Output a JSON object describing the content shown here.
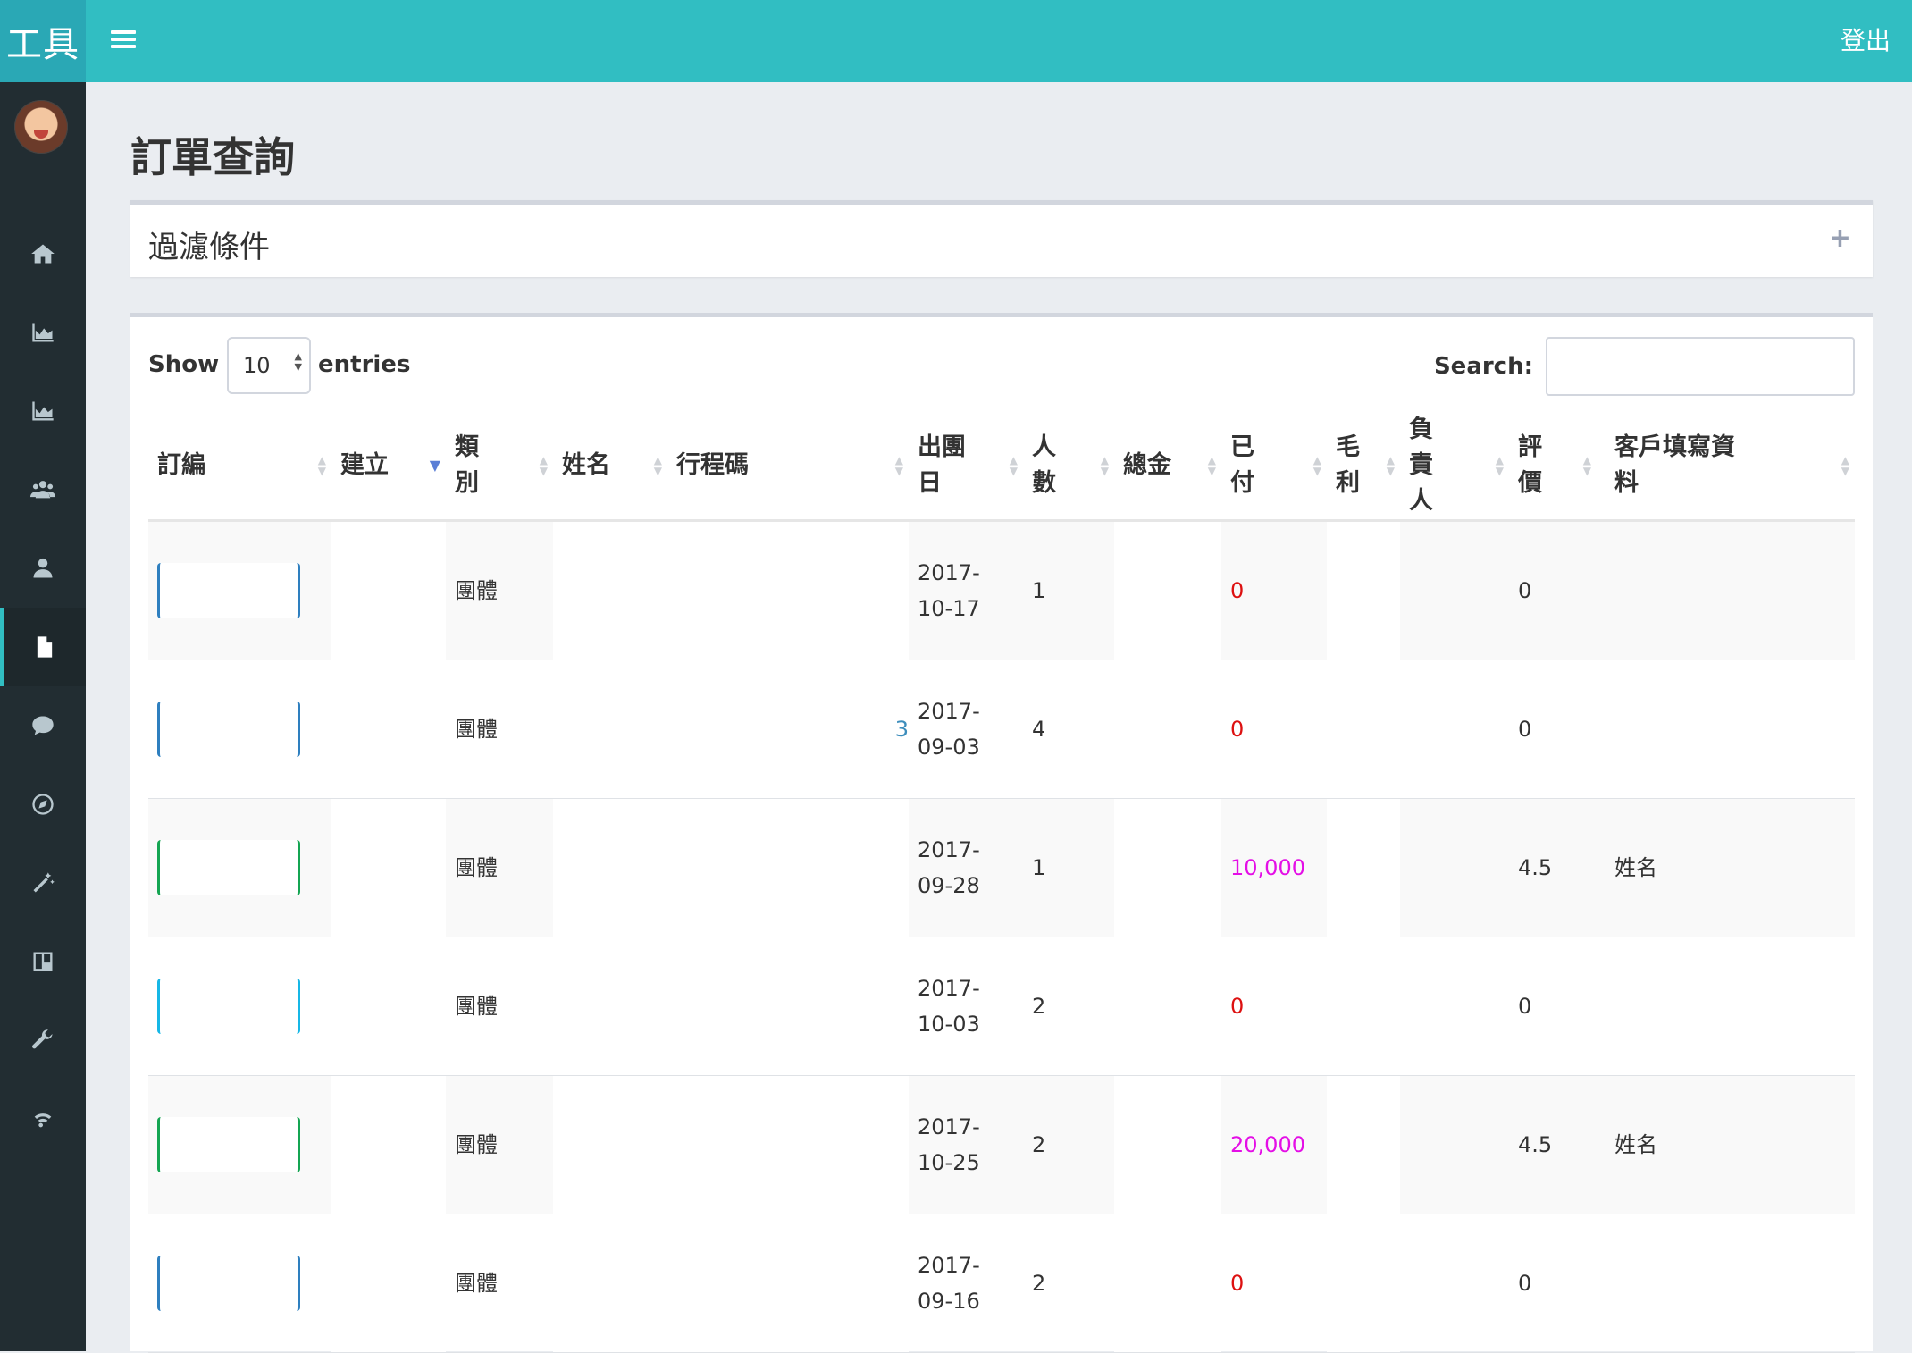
{
  "app": {
    "logo": "工具",
    "logout": "登出"
  },
  "sidebar": {
    "items": [
      {
        "icon": "home-icon"
      },
      {
        "icon": "area-chart-icon"
      },
      {
        "icon": "area-chart-icon"
      },
      {
        "icon": "users-icon"
      },
      {
        "icon": "user-icon"
      },
      {
        "icon": "file-icon",
        "active": true
      },
      {
        "icon": "comment-icon"
      },
      {
        "icon": "compass-icon"
      },
      {
        "icon": "magic-wand-icon"
      },
      {
        "icon": "board-icon"
      },
      {
        "icon": "wrench-icon"
      },
      {
        "icon": "wifi-icon"
      }
    ]
  },
  "page": {
    "title": "訂單查詢"
  },
  "filter": {
    "title": "過濾條件",
    "toggle": "+"
  },
  "table_controls": {
    "show": "Show",
    "length": "10",
    "entries": "entries",
    "search_label": "Search:"
  },
  "columns": [
    "訂編",
    "建立",
    "類別",
    "姓名",
    "行程碼",
    "出團日",
    "人數",
    "總金",
    "已付",
    "毛利",
    "負責人",
    "評價",
    "客戶填寫資料"
  ],
  "rows": [
    {
      "btn": "blue",
      "type": "團體",
      "date": "2017-10-17",
      "people": "1",
      "paid": "0",
      "paid_color": "red",
      "rating": "0",
      "client": ""
    },
    {
      "btn": "blue",
      "type": "團體",
      "date": "2017-09-03",
      "people": "4",
      "paid": "0",
      "paid_color": "red",
      "rating": "0",
      "client": "",
      "code_tail": "3"
    },
    {
      "btn": "green",
      "type": "團體",
      "date": "2017-09-28",
      "people": "1",
      "paid": "10,000",
      "paid_color": "pink",
      "rating": "4.5",
      "client": "姓名"
    },
    {
      "btn": "cyan",
      "type": "團體",
      "date": "2017-10-03",
      "people": "2",
      "paid": "0",
      "paid_color": "red",
      "rating": "0",
      "client": ""
    },
    {
      "btn": "green",
      "type": "團體",
      "date": "2017-10-25",
      "people": "2",
      "paid": "20,000",
      "paid_color": "pink",
      "rating": "4.5",
      "client": "姓名"
    },
    {
      "btn": "blue",
      "type": "團體",
      "date": "2017-09-16",
      "people": "2",
      "paid": "0",
      "paid_color": "red",
      "rating": "0",
      "client": ""
    }
  ],
  "colors": {
    "topbar": "#31bec2",
    "sidebar": "#222d32",
    "paid_zero": "#dd1111",
    "paid_amount": "#e40fe6"
  }
}
